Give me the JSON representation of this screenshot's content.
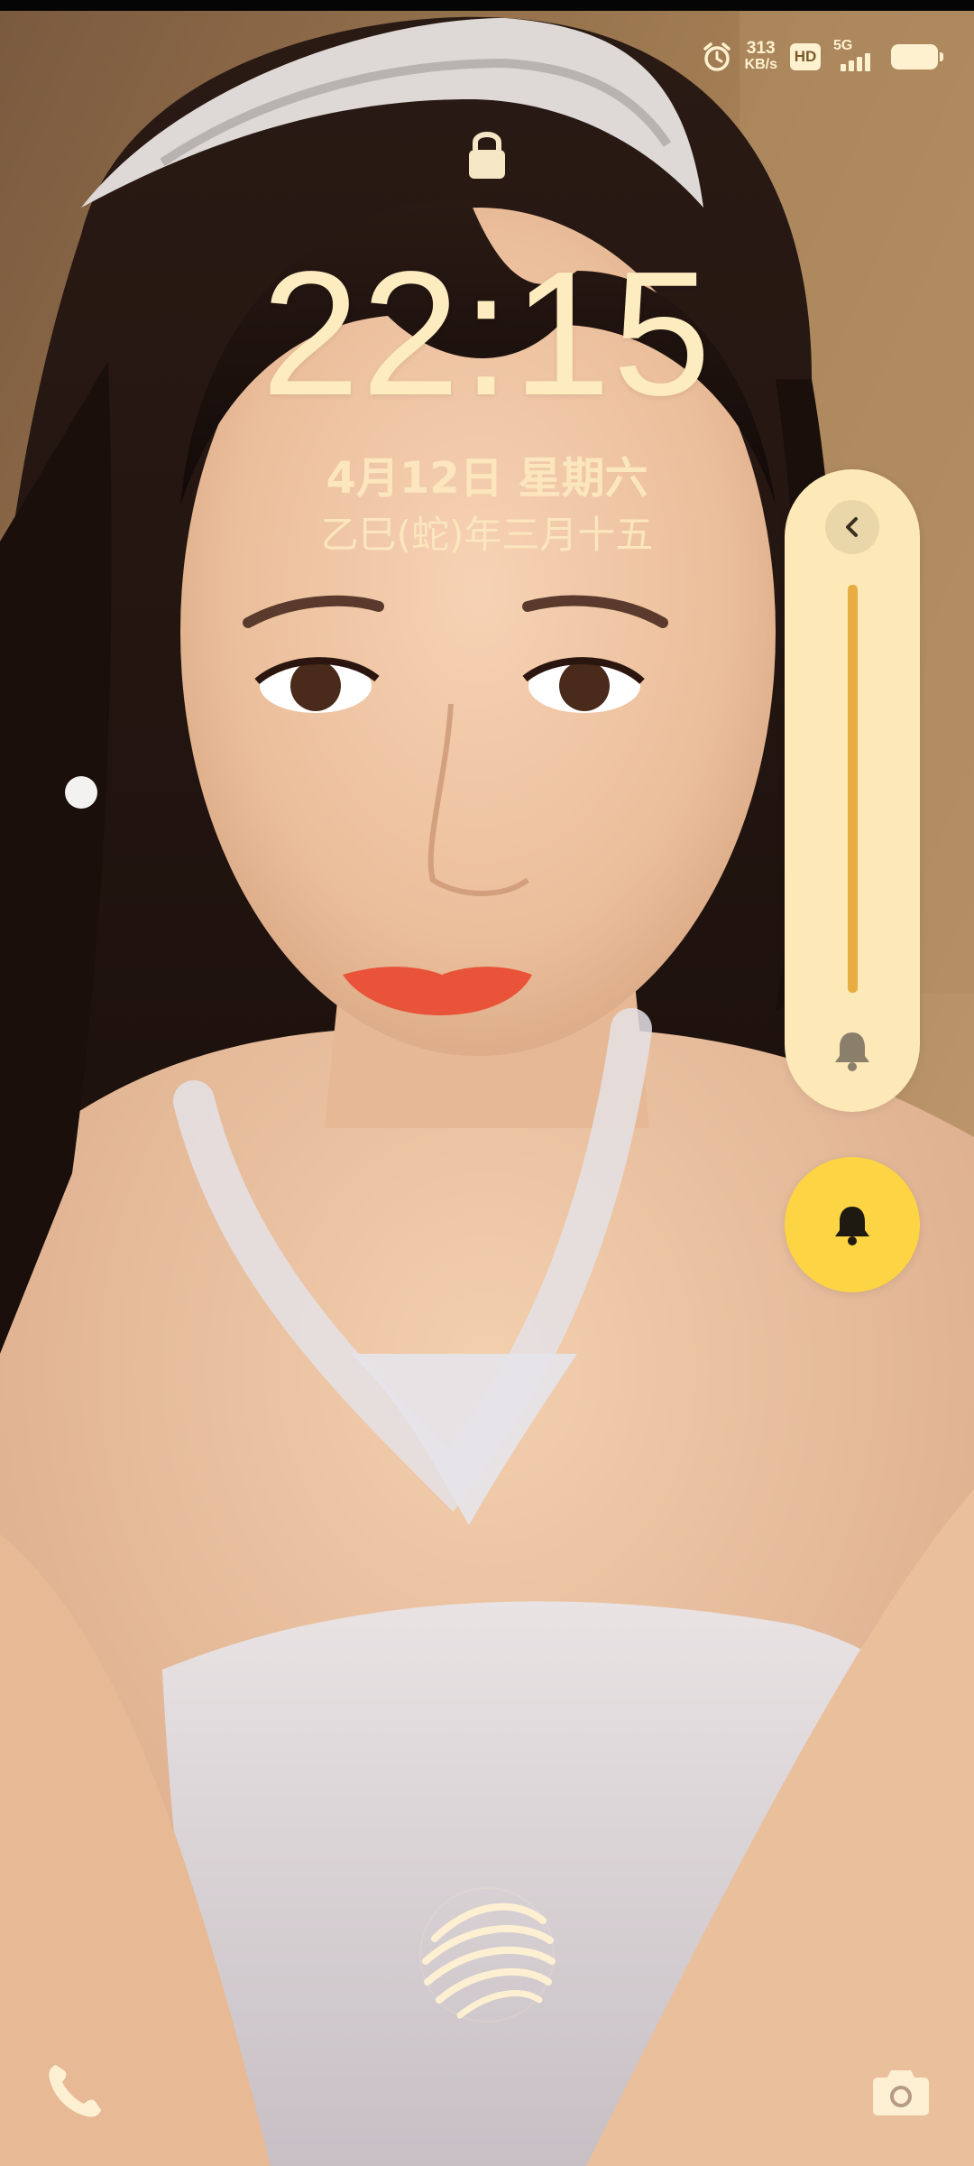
{
  "status_bar": {
    "alarm_icon": "alarm-clock-icon",
    "net_speed_value": "313",
    "net_speed_unit": "KB/s",
    "hd_label": "HD",
    "network_label": "5G",
    "signal_icon": "cellular-signal-icon",
    "battery_icon": "battery-icon"
  },
  "lock_screen": {
    "lock_icon": "padlock-icon",
    "time": "22:15",
    "date": "4月12日 星期六",
    "lunar_date": "乙巳(蛇)年三月十五"
  },
  "volume_panel": {
    "collapse_icon": "chevron-left-icon",
    "level_fraction": 1.0,
    "bell_icon": "bell-icon"
  },
  "ringer_button": {
    "icon": "bell-icon"
  },
  "shortcuts": {
    "left_icon": "phone-icon",
    "right_icon": "camera-icon",
    "fingerprint_icon": "fingerprint-sphere-icon"
  },
  "colors": {
    "text": "#fdecc0",
    "panel_bg": "#fde9b7",
    "slider": "#e8ad42",
    "ringer_button": "#fdd443"
  }
}
